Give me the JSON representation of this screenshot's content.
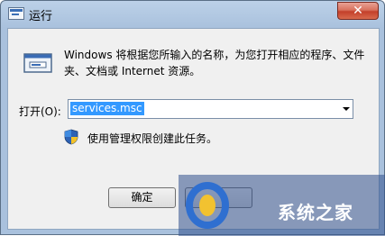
{
  "window": {
    "title": "运行",
    "close_glyph": "✕"
  },
  "dialog": {
    "description": "Windows 将根据您所输入的名称，为您打开相应的程序、文件夹、文档或 Internet 资源。",
    "open_label": "打开(O):",
    "open_value": "services.msc",
    "admin_note": "使用管理权限创建此任务。",
    "ok_label": "确定"
  },
  "watermark": {
    "text": "系统之家"
  },
  "colors": {
    "selection": "#3399ff",
    "titlebar": "#a9c1dd",
    "close_button": "#c3402a"
  },
  "icons": {
    "title": "run-app-icon",
    "run": "run-window-icon",
    "shield": "uac-shield-icon"
  }
}
